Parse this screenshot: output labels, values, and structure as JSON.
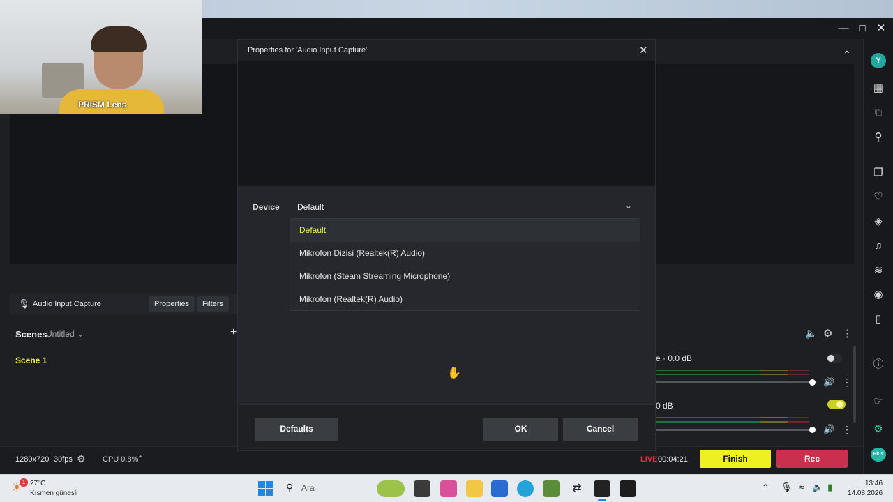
{
  "webcam": {
    "label": "PRISM Lens"
  },
  "dialog": {
    "title": "Properties for 'Audio Input Capture'",
    "device_label": "Device",
    "device_value": "Default",
    "options": [
      "Default",
      "Mikrofon Dizisi (Realtek(R) Audio)",
      "Mikrofon (Steam Streaming Microphone)",
      "Mikrofon (Realtek(R) Audio)"
    ],
    "selected_index": 0,
    "buttons": {
      "defaults": "Defaults",
      "ok": "OK",
      "cancel": "Cancel"
    }
  },
  "source_bar": {
    "source_name": "Audio Input Capture",
    "properties": "Properties",
    "filters": "Filters"
  },
  "scenes": {
    "title": "Scenes",
    "collection": "Untitled",
    "items": [
      "Scene 1"
    ]
  },
  "mixer": {
    "track1_level": "e · 0.0 dB",
    "track2_level": "0 dB"
  },
  "status_bar": {
    "resolution": "1280x720",
    "fps": "30fps",
    "cpu": "CPU 0.8%",
    "live_badge": "LIVE",
    "live_time": "00:04:21",
    "finish": "Finish",
    "rec": "Rec"
  },
  "taskbar": {
    "weather_temp": "27°C",
    "weather_desc": "Kısmen güneşli",
    "weather_badge": "1",
    "search_placeholder": "Ara",
    "time": "13:46",
    "date": "14.08.2026"
  },
  "right_rail": {
    "avatar_letter": "Y",
    "plus_badge": "Plus"
  },
  "colors": {
    "accent_yellow": "#eef022",
    "rec_red": "#c8304e",
    "live_red": "#e0323f",
    "scene_active": "#e9f04a"
  }
}
